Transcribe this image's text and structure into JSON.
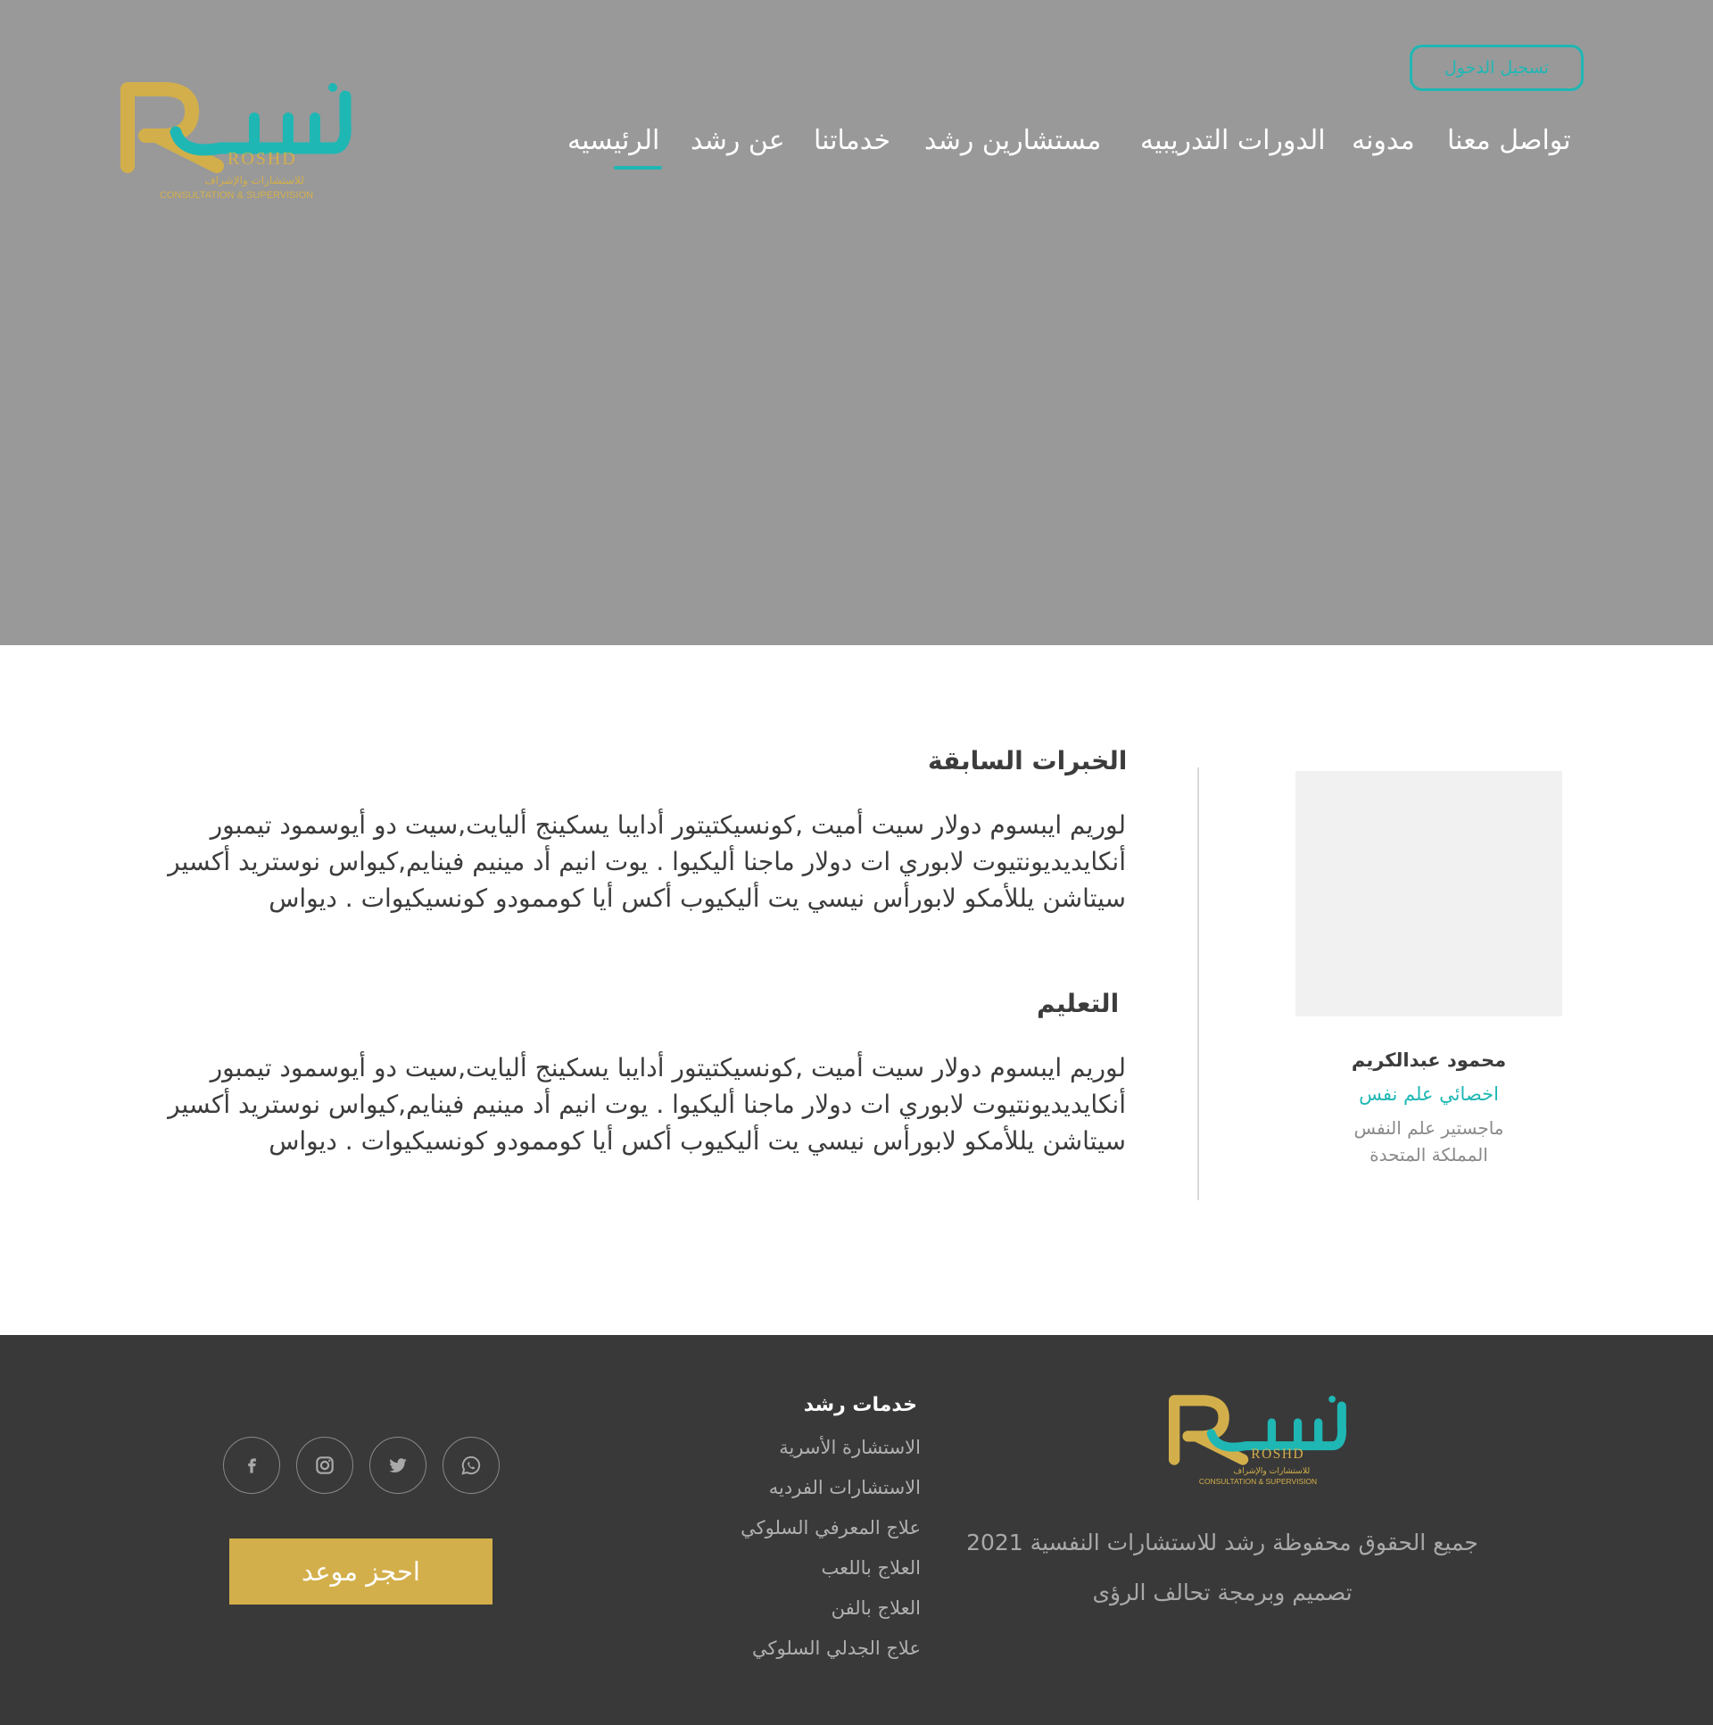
{
  "header": {
    "logo": {
      "brand_ar": "رُشد",
      "brand_en": "ROSHD",
      "tagline_ar": "للاستشارات والإشراف",
      "tagline_en": "CONSULTATION & SUPERVISION"
    },
    "login_label": "تسجيل الدخول",
    "nav": {
      "contact": "تواصل معنا",
      "blog": "مدونه",
      "courses": "الدورات التدريبيه",
      "consultants": "مستشارين رشد",
      "services": "خدماتنا",
      "about": "عن رشد",
      "home": "الرئيسيه"
    },
    "active_nav": "home"
  },
  "profile": {
    "name": "محمود عبدالكريم",
    "role": "اخصائي علم نفس",
    "degree": "ماجستير علم النفس",
    "country": "المملكة المتحدة"
  },
  "experience": {
    "title": "الخبرات السابقة",
    "text": "لوريم ايبسوم دولار سيت أميت ,كونسيكتيتور أدايبا يسكينج أليايت,سيت دو أيوسمود تيمبور أنكايديديونتيوت لابوري ات دولار ماجنا أليكيوا . يوت انيم أد مينيم فينايم,كيواس نوستريد أكسير سيتاشن يللأمكو لابورأس نيسي يت أليكيوب أكس أيا كوممودو كونسيكيوات . ديواس"
  },
  "education": {
    "title": "التعليم",
    "text": "لوريم ايبسوم دولار سيت أميت ,كونسيكتيتور أدايبا يسكينج أليايت,سيت دو أيوسمود تيمبور أنكايديديونتيوت لابوري ات دولار ماجنا أليكيوا . يوت انيم أد مينيم فينايم,كيواس نوستريد أكسير سيتاشن يللأمكو لابورأس نيسي يت أليكيوب أكس أيا كوممودو كونسيكيوات . ديواس"
  },
  "footer": {
    "copyright": "جميع الحقوق محفوظة رشد للاستشارات النفسية   2021",
    "credits": "تصميم وبرمجة تحالف الرؤى",
    "services_title": "خدمات رشد",
    "services": [
      "الاستشارة الأسرية",
      "الاستشارات الفرديه",
      "علاج المعرفي السلوكي",
      "العلاج باللعب",
      "العلاج بالفن",
      "علاج الجدلي السلوكي"
    ],
    "social_icons": [
      "facebook-icon",
      "instagram-icon",
      "twitter-icon",
      "whatsapp-icon"
    ],
    "book_label": "احجز موعد"
  },
  "colors": {
    "hero_bg": "#999999",
    "accent_teal": "#1fb7b4",
    "accent_gold": "#d3af4b",
    "footer_bg": "#393939"
  }
}
